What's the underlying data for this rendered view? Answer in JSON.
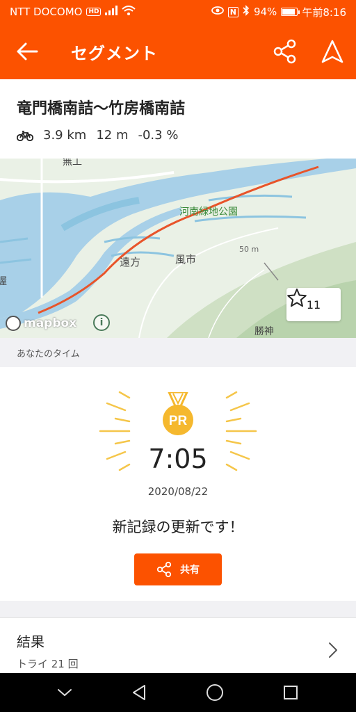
{
  "status_bar": {
    "carrier": "NTT DOCOMO",
    "hd": "HD",
    "nfc": "N",
    "battery": "94%",
    "battery_level": 0.94,
    "time": "午前8:16"
  },
  "app_bar": {
    "title": "セグメント"
  },
  "segment": {
    "name": "竜門橋南詰～竹房橋南詰",
    "distance": "3.9 km",
    "elevation": "12 m",
    "grade": "-0.3 %"
  },
  "map": {
    "labels": {
      "park": "河南緑地公園",
      "place1": "遠方",
      "place2": "風市",
      "place3": "勝神",
      "contour": "50 m",
      "edge_top": "無工",
      "edge_left": "渥"
    },
    "attribution": "mapbox",
    "star_count": "11",
    "route_color": "#e8542a"
  },
  "section": {
    "your_time": "あなたのタイム"
  },
  "pr": {
    "badge": "PR",
    "time": "7:05",
    "date": "2020/08/22",
    "message": "新記録の更新です！",
    "share_label": "共有"
  },
  "results": {
    "title": "結果",
    "attempts": "トライ 21 回"
  },
  "colors": {
    "accent": "#fc5200",
    "medal": "#f5b82e"
  }
}
